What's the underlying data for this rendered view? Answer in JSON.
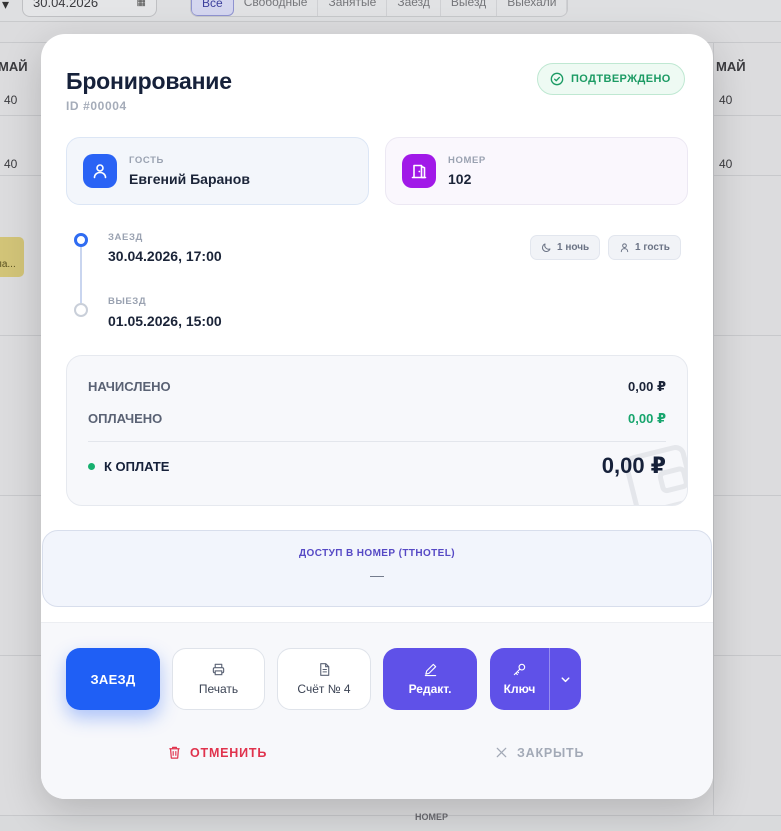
{
  "background": {
    "date_value": "30.04.2026",
    "filters": [
      "Все",
      "Свободные",
      "Занятые",
      "Заезд",
      "Выезд",
      "Выехали"
    ],
    "day_label": "МАЙ",
    "numbers": [
      "40",
      "40"
    ],
    "booking_text": "ла...",
    "bottom_label": "НОМЕР"
  },
  "modal": {
    "title": "Бронирование",
    "id": "ID #00004",
    "status": "ПОДТВЕРЖДЕНО",
    "guest": {
      "label": "ГОСТЬ",
      "name": "Евгений Баранов"
    },
    "room": {
      "label": "НОМЕР",
      "number": "102"
    },
    "checkin": {
      "label": "ЗАЕЗД",
      "value": "30.04.2026, 17:00"
    },
    "checkout": {
      "label": "ВЫЕЗД",
      "value": "01.05.2026, 15:00"
    },
    "chips": {
      "nights": "1 ночь",
      "guests": "1 гость"
    },
    "summary": {
      "charged_label": "НАЧИСЛЕНО",
      "charged_value": "0,00 ₽",
      "paid_label": "ОПЛАЧЕНО",
      "paid_value": "0,00 ₽",
      "due_label": "К ОПЛАТЕ",
      "due_value": "0,00 ₽"
    },
    "access": {
      "title": "ДОСТУП В НОМЕР (TTHOTEL)",
      "value": "—"
    },
    "actions": {
      "checkin": "ЗАЕЗД",
      "print": "Печать",
      "invoice": "Счёт № 4",
      "edit": "Редакт.",
      "key": "Ключ",
      "cancel": "ОТМЕНИТЬ",
      "close": "ЗАКРЫТЬ"
    }
  },
  "colors": {
    "accent_blue": "#1f5ff5",
    "accent_purple": "#5f51e8",
    "status_green": "#1c9b64",
    "danger_red": "#e0334d"
  }
}
